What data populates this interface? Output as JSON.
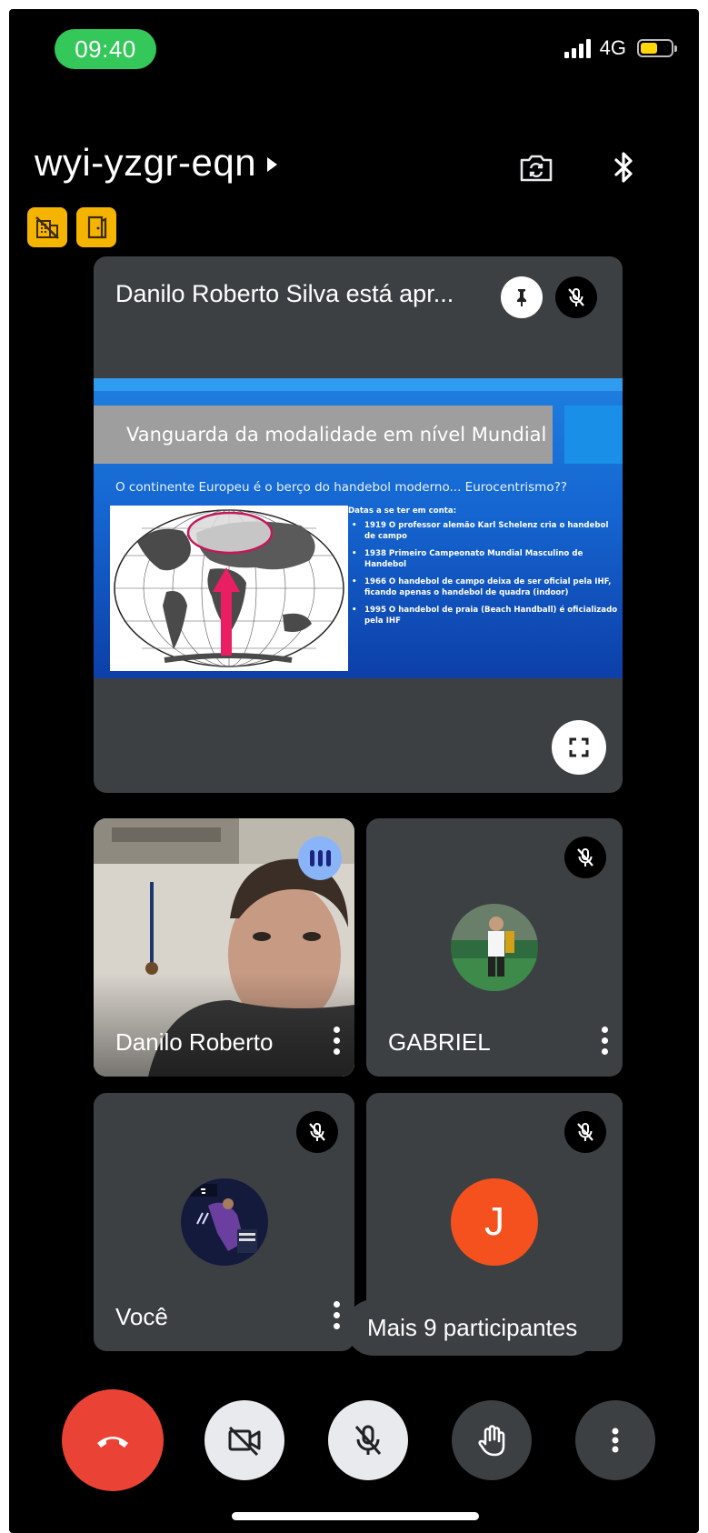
{
  "status_bar": {
    "time": "09:40",
    "network": "4G",
    "battery_level": 0.55,
    "colors": {
      "time_pill": "#34c759",
      "battery": "#ffd60a"
    }
  },
  "header": {
    "meeting_code": "wyi-yzgr-eqn",
    "icons": [
      "switch-camera-icon",
      "bluetooth-icon"
    ],
    "badges": [
      "building-alert-icon",
      "door-exit-icon"
    ]
  },
  "presentation": {
    "presenter_label": "Danilo Roberto Silva está apr...",
    "icons": [
      "pin-icon",
      "mic-off-icon",
      "fullscreen-icon"
    ],
    "slide": {
      "title": "Vanguarda da modalidade em nível Mundial",
      "subtitle": "O continente Europeu é o berço do handebol moderno... Eurocentrismo??",
      "bullets_heading": "Datas a se ter em conta:",
      "bullets": [
        "1919 O professor alemão Karl Schelenz cria o handebol de campo",
        "1938 Primeiro Campeonato Mundial Masculino de Handebol",
        "1966 O handebol de campo deixa de ser oficial pela IHF, ficando apenas o handebol de quadra (indoor)",
        "1995 O handebol de praia (Beach Handball) é oficializado pela IHF"
      ]
    }
  },
  "participants": [
    {
      "name": "Danilo Roberto",
      "state": "speaking",
      "video": "camera"
    },
    {
      "name": "GABRIEL",
      "state": "muted",
      "video": "avatar-photo"
    },
    {
      "name": "Você",
      "state": "muted",
      "video": "avatar-photo"
    },
    {
      "name": "",
      "initial": "J",
      "state": "muted",
      "video": "initial-avatar",
      "avatar_color": "#f4511e"
    }
  ],
  "more_participants": "Mais 9 participantes",
  "controls": {
    "items": [
      "end-call-icon",
      "camera-off-icon",
      "mic-off-icon",
      "raise-hand-icon",
      "more-options-icon"
    ],
    "end_call_color": "#ea4335"
  }
}
